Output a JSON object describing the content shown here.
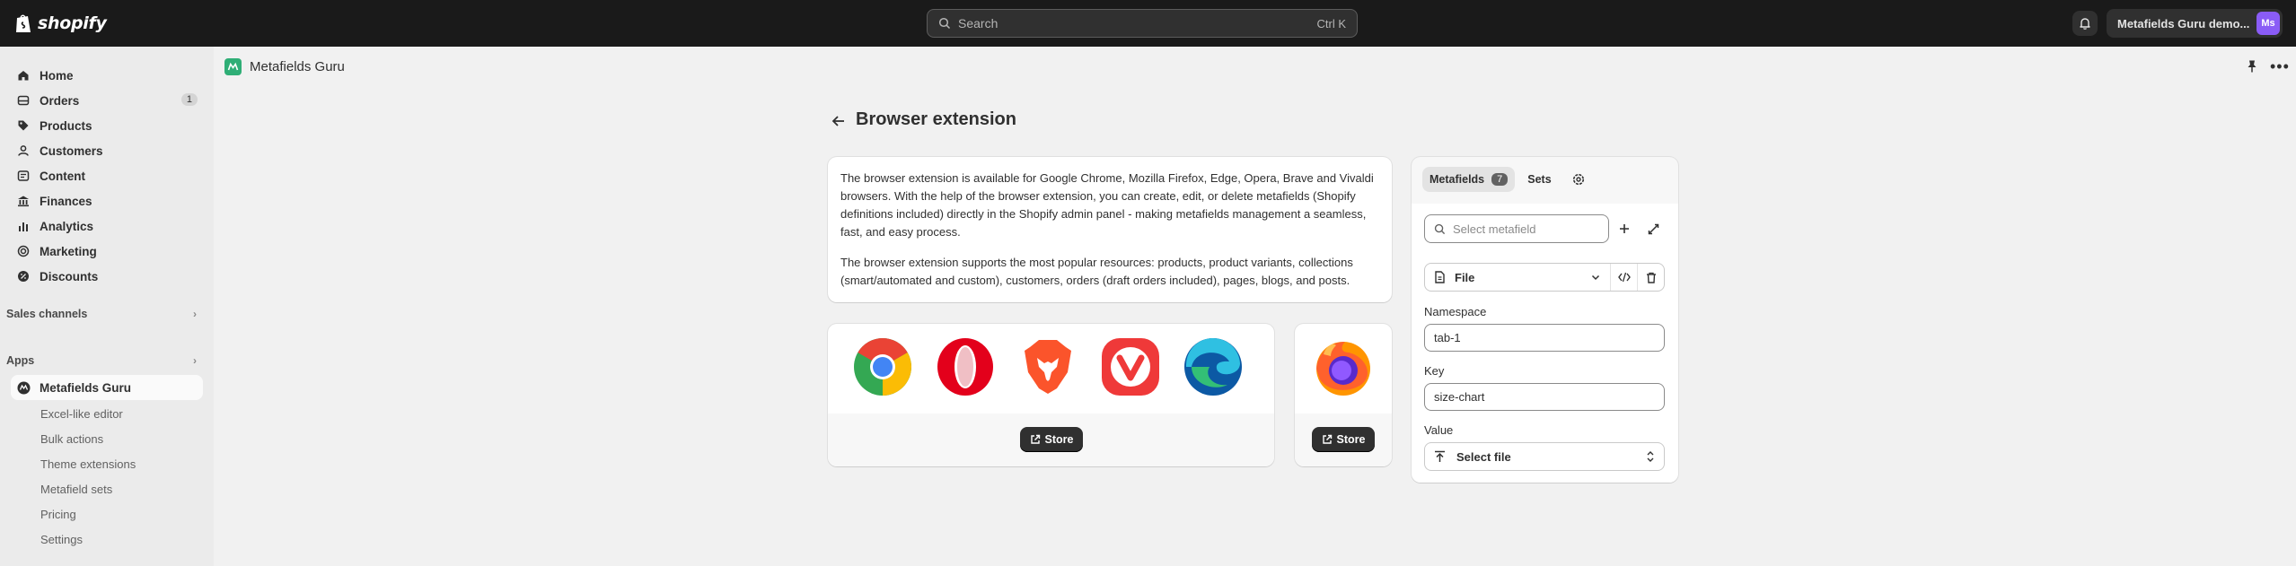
{
  "topbar": {
    "logo_text": "shopify",
    "search_placeholder": "Search",
    "search_shortcut": "Ctrl K",
    "store_name": "Metafields Guru demo...",
    "avatar_initials": "Ms"
  },
  "sidebar": {
    "items": [
      {
        "label": "Home",
        "icon": "home-icon"
      },
      {
        "label": "Orders",
        "icon": "orders-icon",
        "badge": "1"
      },
      {
        "label": "Products",
        "icon": "tag-icon"
      },
      {
        "label": "Customers",
        "icon": "person-icon"
      },
      {
        "label": "Content",
        "icon": "content-icon"
      },
      {
        "label": "Finances",
        "icon": "bank-icon"
      },
      {
        "label": "Analytics",
        "icon": "chart-icon"
      },
      {
        "label": "Marketing",
        "icon": "target-icon"
      },
      {
        "label": "Discounts",
        "icon": "discount-icon"
      }
    ],
    "sales_channels_label": "Sales channels",
    "apps_label": "Apps",
    "active_app": "Metafields Guru",
    "sub_items": [
      "Excel-like editor",
      "Bulk actions",
      "Theme extensions",
      "Metafield sets",
      "Pricing",
      "Settings"
    ]
  },
  "app_header": {
    "title": "Metafields Guru"
  },
  "page": {
    "title": "Browser extension",
    "paragraph_1": "The browser extension is available for Google Chrome, Mozilla Firefox, Edge, Opera, Brave and Vivaldi browsers. With the help of the browser extension, you can create, edit, or delete metafields (Shopify definitions included) directly in the Shopify admin panel - making metafields management a seamless, fast, and easy process.",
    "paragraph_2": "The browser extension supports the most popular resources: products, product variants, collections (smart/automated and custom), customers, orders (draft orders included), pages, blogs, and posts.",
    "browsers": [
      "Chrome",
      "Opera",
      "Brave",
      "Vivaldi",
      "Edge"
    ],
    "store_button_label": "Store",
    "firefox_store_button_label": "Store"
  },
  "metafields_panel": {
    "tab_metafields": "Metafields",
    "tab_metafields_count": "7",
    "tab_sets": "Sets",
    "select_placeholder": "Select metafield",
    "type_label": "File",
    "namespace_label": "Namespace",
    "namespace_value": "tab-1",
    "key_label": "Key",
    "key_value": "size-chart",
    "value_label": "Value",
    "select_file_label": "Select file"
  },
  "colors": {
    "topbar_bg": "#1a1a1a",
    "app_green": "#2fae76",
    "avatar": "#8a5cf6",
    "button_dark": "#303030"
  }
}
